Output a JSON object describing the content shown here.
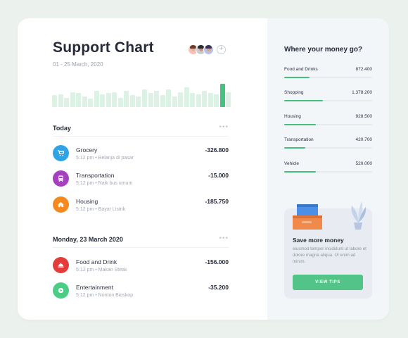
{
  "header": {
    "title": "Support Chart",
    "date_range": "01 - 25 March, 2020",
    "add_label": "+"
  },
  "avatars": [
    {
      "name": "avatar-1",
      "bg": "#f4c2b8",
      "hair": "#6b3b2a",
      "skin": "#e9b096"
    },
    {
      "name": "avatar-2",
      "bg": "#c9cdd6",
      "hair": "#2b2b2b",
      "skin": "#c99374"
    },
    {
      "name": "avatar-3",
      "bg": "#b9c0e8",
      "hair": "#3a3550",
      "skin": "#d6a688"
    }
  ],
  "chart_data": {
    "type": "bar",
    "values": [
      10,
      11,
      8,
      13,
      12,
      9,
      7,
      14,
      11,
      12,
      13,
      8,
      14,
      10,
      9,
      15,
      12,
      14,
      10,
      15,
      9,
      13,
      17,
      12,
      11,
      14,
      12,
      11,
      20,
      13
    ],
    "highlight_index": 28,
    "colors": {
      "normal": "#dcf2e5",
      "highlight": "#46c17f"
    }
  },
  "sections": [
    {
      "label": "Today",
      "dots": "•••",
      "items": [
        {
          "name": "Grocery",
          "time": "5:12 pm",
          "sep": "•",
          "note": "Belanja di pasar",
          "amount": "-326.800",
          "color": "#2ea3e5",
          "icon": "cart-icon"
        },
        {
          "name": "Transportation",
          "time": "5:12 pm",
          "sep": "•",
          "note": "Naik bus umum",
          "amount": "-15.000",
          "color": "#a540be",
          "icon": "bus-icon"
        },
        {
          "name": "Housing",
          "time": "5:12 pm",
          "sep": "•",
          "note": "Bayar Listrik",
          "amount": "-185.750",
          "color": "#f5891f",
          "icon": "home-icon"
        }
      ]
    },
    {
      "label": "Monday, 23 March 2020",
      "dots": "•••",
      "items": [
        {
          "name": "Food and Drink",
          "time": "5:12 pm",
          "sep": "•",
          "note": "Makan Steak",
          "amount": "-156.000",
          "color": "#e43b3b",
          "icon": "food-icon"
        },
        {
          "name": "Entertainment",
          "time": "5:12 pm",
          "sep": "•",
          "note": "Nonton Bioskop",
          "amount": "-35.200",
          "color": "#4ccd86",
          "icon": "play-icon"
        }
      ]
    }
  ],
  "sidebar": {
    "title": "Where your money go?",
    "categories": [
      {
        "name": "Food and Drinks",
        "value": "872.400",
        "fill": 0.29
      },
      {
        "name": "Shopping",
        "value": "1.378.200",
        "fill": 0.44
      },
      {
        "name": "Housing",
        "value": "928.500",
        "fill": 0.36
      },
      {
        "name": "Transportation",
        "value": "420.700",
        "fill": 0.24
      },
      {
        "name": "Vehicle",
        "value": "520.000",
        "fill": 0.36
      }
    ],
    "promo": {
      "title": "Save more money",
      "description": "eiusmod tempor incididunt ut labore et dolore magna aliqua. Ut enim ad minim.",
      "button": "VIEW TIPS"
    }
  }
}
